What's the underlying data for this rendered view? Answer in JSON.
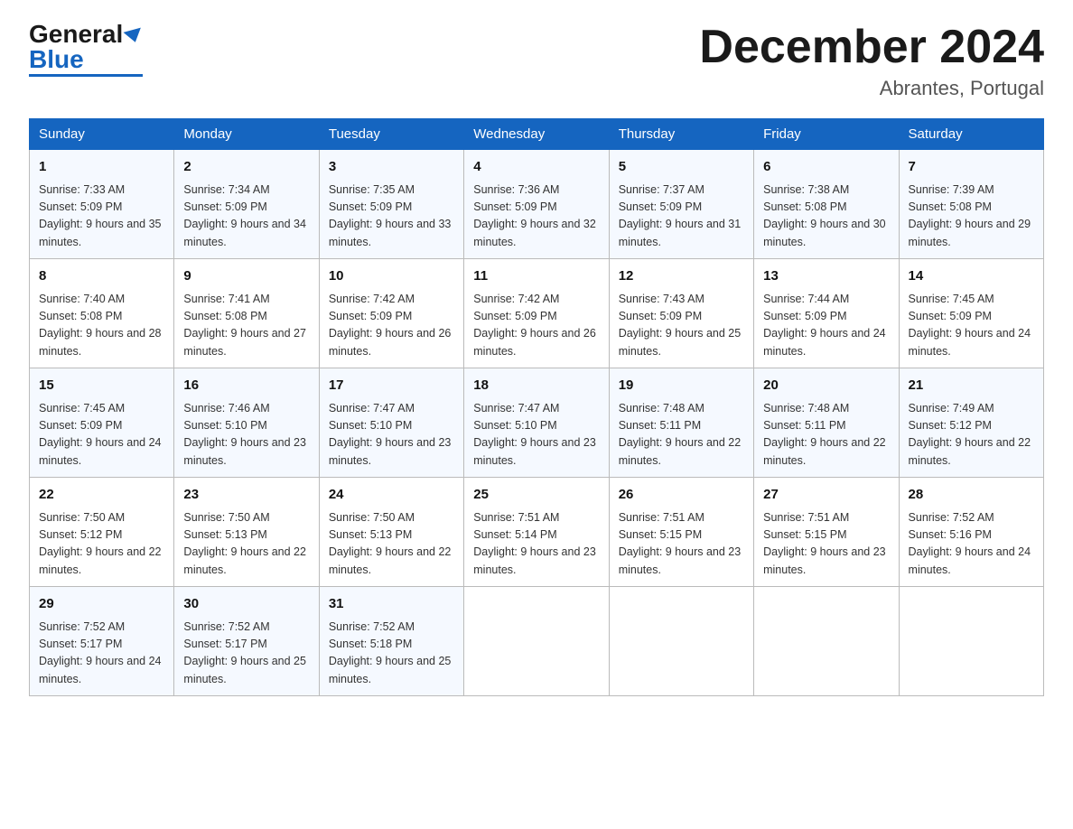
{
  "header": {
    "logo_general": "General",
    "logo_triangle": "▶",
    "logo_blue": "Blue",
    "month_title": "December 2024",
    "location": "Abrantes, Portugal"
  },
  "days_of_week": [
    "Sunday",
    "Monday",
    "Tuesday",
    "Wednesday",
    "Thursday",
    "Friday",
    "Saturday"
  ],
  "weeks": [
    [
      {
        "day": "1",
        "sunrise": "7:33 AM",
        "sunset": "5:09 PM",
        "daylight": "9 hours and 35 minutes."
      },
      {
        "day": "2",
        "sunrise": "7:34 AM",
        "sunset": "5:09 PM",
        "daylight": "9 hours and 34 minutes."
      },
      {
        "day": "3",
        "sunrise": "7:35 AM",
        "sunset": "5:09 PM",
        "daylight": "9 hours and 33 minutes."
      },
      {
        "day": "4",
        "sunrise": "7:36 AM",
        "sunset": "5:09 PM",
        "daylight": "9 hours and 32 minutes."
      },
      {
        "day": "5",
        "sunrise": "7:37 AM",
        "sunset": "5:09 PM",
        "daylight": "9 hours and 31 minutes."
      },
      {
        "day": "6",
        "sunrise": "7:38 AM",
        "sunset": "5:08 PM",
        "daylight": "9 hours and 30 minutes."
      },
      {
        "day": "7",
        "sunrise": "7:39 AM",
        "sunset": "5:08 PM",
        "daylight": "9 hours and 29 minutes."
      }
    ],
    [
      {
        "day": "8",
        "sunrise": "7:40 AM",
        "sunset": "5:08 PM",
        "daylight": "9 hours and 28 minutes."
      },
      {
        "day": "9",
        "sunrise": "7:41 AM",
        "sunset": "5:08 PM",
        "daylight": "9 hours and 27 minutes."
      },
      {
        "day": "10",
        "sunrise": "7:42 AM",
        "sunset": "5:09 PM",
        "daylight": "9 hours and 26 minutes."
      },
      {
        "day": "11",
        "sunrise": "7:42 AM",
        "sunset": "5:09 PM",
        "daylight": "9 hours and 26 minutes."
      },
      {
        "day": "12",
        "sunrise": "7:43 AM",
        "sunset": "5:09 PM",
        "daylight": "9 hours and 25 minutes."
      },
      {
        "day": "13",
        "sunrise": "7:44 AM",
        "sunset": "5:09 PM",
        "daylight": "9 hours and 24 minutes."
      },
      {
        "day": "14",
        "sunrise": "7:45 AM",
        "sunset": "5:09 PM",
        "daylight": "9 hours and 24 minutes."
      }
    ],
    [
      {
        "day": "15",
        "sunrise": "7:45 AM",
        "sunset": "5:09 PM",
        "daylight": "9 hours and 24 minutes."
      },
      {
        "day": "16",
        "sunrise": "7:46 AM",
        "sunset": "5:10 PM",
        "daylight": "9 hours and 23 minutes."
      },
      {
        "day": "17",
        "sunrise": "7:47 AM",
        "sunset": "5:10 PM",
        "daylight": "9 hours and 23 minutes."
      },
      {
        "day": "18",
        "sunrise": "7:47 AM",
        "sunset": "5:10 PM",
        "daylight": "9 hours and 23 minutes."
      },
      {
        "day": "19",
        "sunrise": "7:48 AM",
        "sunset": "5:11 PM",
        "daylight": "9 hours and 22 minutes."
      },
      {
        "day": "20",
        "sunrise": "7:48 AM",
        "sunset": "5:11 PM",
        "daylight": "9 hours and 22 minutes."
      },
      {
        "day": "21",
        "sunrise": "7:49 AM",
        "sunset": "5:12 PM",
        "daylight": "9 hours and 22 minutes."
      }
    ],
    [
      {
        "day": "22",
        "sunrise": "7:50 AM",
        "sunset": "5:12 PM",
        "daylight": "9 hours and 22 minutes."
      },
      {
        "day": "23",
        "sunrise": "7:50 AM",
        "sunset": "5:13 PM",
        "daylight": "9 hours and 22 minutes."
      },
      {
        "day": "24",
        "sunrise": "7:50 AM",
        "sunset": "5:13 PM",
        "daylight": "9 hours and 22 minutes."
      },
      {
        "day": "25",
        "sunrise": "7:51 AM",
        "sunset": "5:14 PM",
        "daylight": "9 hours and 23 minutes."
      },
      {
        "day": "26",
        "sunrise": "7:51 AM",
        "sunset": "5:15 PM",
        "daylight": "9 hours and 23 minutes."
      },
      {
        "day": "27",
        "sunrise": "7:51 AM",
        "sunset": "5:15 PM",
        "daylight": "9 hours and 23 minutes."
      },
      {
        "day": "28",
        "sunrise": "7:52 AM",
        "sunset": "5:16 PM",
        "daylight": "9 hours and 24 minutes."
      }
    ],
    [
      {
        "day": "29",
        "sunrise": "7:52 AM",
        "sunset": "5:17 PM",
        "daylight": "9 hours and 24 minutes."
      },
      {
        "day": "30",
        "sunrise": "7:52 AM",
        "sunset": "5:17 PM",
        "daylight": "9 hours and 25 minutes."
      },
      {
        "day": "31",
        "sunrise": "7:52 AM",
        "sunset": "5:18 PM",
        "daylight": "9 hours and 25 minutes."
      },
      null,
      null,
      null,
      null
    ]
  ]
}
